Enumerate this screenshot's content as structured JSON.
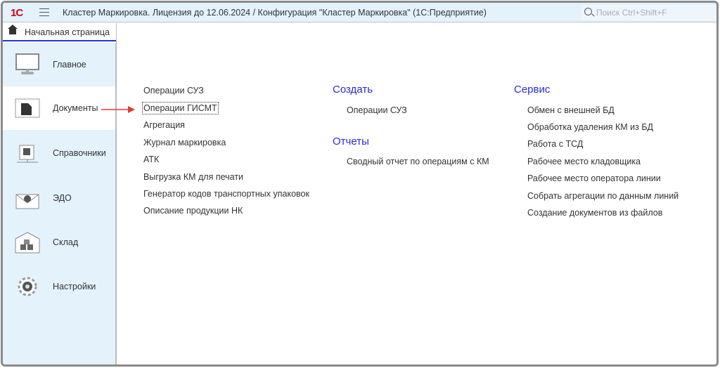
{
  "app": {
    "logo": "1С",
    "title": "Кластер Маркировка. Лицензия до 12.06.2024 / Конфигурация \"Кластер Маркировка\"  (1С:Предприятие)",
    "search_placeholder": "Поиск Ctrl+Shift+F"
  },
  "tab": {
    "label": "Начальная страница"
  },
  "sidebar": {
    "items": [
      {
        "label": "Главное",
        "icon": "monitor-icon"
      },
      {
        "label": "Документы",
        "icon": "document-icon"
      },
      {
        "label": "Справочники",
        "icon": "catalog-icon"
      },
      {
        "label": "ЭДО",
        "icon": "envelope-lock-icon"
      },
      {
        "label": "Склад",
        "icon": "warehouse-icon"
      },
      {
        "label": "Настройки",
        "icon": "gear-icon"
      }
    ]
  },
  "main": {
    "col1": [
      "Операции СУЗ",
      "Операции ГИСМТ",
      "Агрегация",
      "Журнал маркировка",
      "АТК",
      "Выгрузка КМ для печати",
      "Генератор кодов транспортных упаковок",
      "Описание продукции НК"
    ],
    "create": {
      "header": "Создать",
      "items": [
        "Операции СУЗ"
      ]
    },
    "reports": {
      "header": "Отчеты",
      "items": [
        "Сводный отчет по операциям с КМ"
      ]
    },
    "service": {
      "header": "Сервис",
      "items": [
        "Обмен с внешней БД",
        "Обработка удаления КМ из БД",
        "Работа с ТСД",
        "Рабочее место кладовщика",
        "Рабочее место оператора линии",
        "Собрать агрегации по данным линий",
        "Создание документов из файлов"
      ]
    }
  },
  "colors": {
    "accent": "#2a2ae0",
    "sidebar_bg": "#e4f2fc",
    "arrow": "#e53935"
  }
}
